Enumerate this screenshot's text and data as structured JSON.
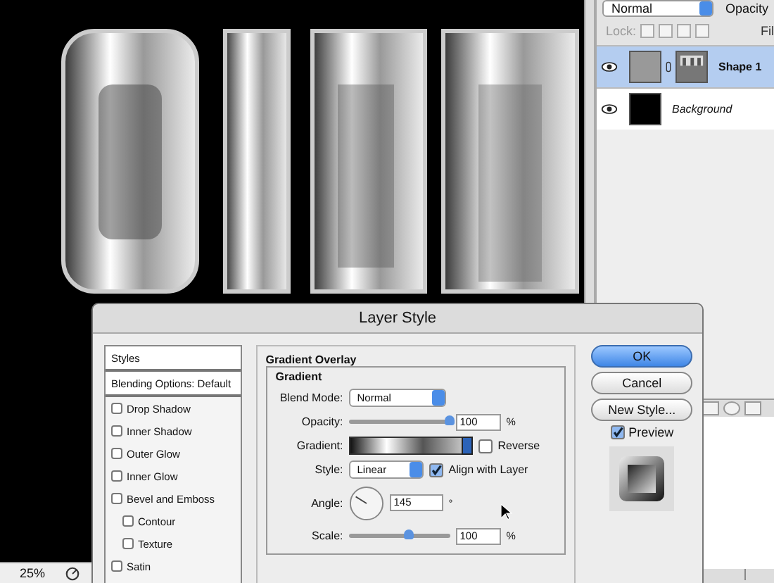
{
  "status_bar": {
    "zoom": "25%"
  },
  "layers_panel": {
    "blend_mode": "Normal",
    "opacity_label": "Opacity",
    "lock_label": "Lock:",
    "fill_label": "Fil",
    "layers": [
      {
        "name": "Shape 1",
        "kind": "shape",
        "selected": true
      },
      {
        "name": "Background",
        "kind": "background",
        "selected": false
      }
    ]
  },
  "dialog": {
    "title": "Layer Style",
    "styles_header": "Styles",
    "blending_options": "Blending Options: Default",
    "effects": [
      {
        "label": "Drop Shadow",
        "checked": false
      },
      {
        "label": "Inner Shadow",
        "checked": false
      },
      {
        "label": "Outer Glow",
        "checked": false
      },
      {
        "label": "Inner Glow",
        "checked": false
      },
      {
        "label": "Bevel and Emboss",
        "checked": false,
        "children": [
          {
            "label": "Contour",
            "checked": false
          },
          {
            "label": "Texture",
            "checked": false
          }
        ]
      },
      {
        "label": "Satin",
        "checked": false
      }
    ],
    "section_title": "Gradient Overlay",
    "group_title": "Gradient",
    "blend_mode": {
      "label": "Blend Mode:",
      "value": "Normal"
    },
    "opacity": {
      "label": "Opacity:",
      "level": 1.0,
      "value": "100",
      "unit": "%"
    },
    "gradient": {
      "label": "Gradient:"
    },
    "reverse": {
      "label": "Reverse",
      "checked": false
    },
    "style": {
      "label": "Style:",
      "value": "Linear"
    },
    "align": {
      "label": "Align with Layer",
      "checked": true
    },
    "angle": {
      "label": "Angle:",
      "value": "145",
      "unit": "°"
    },
    "scale": {
      "label": "Scale:",
      "level": 0.6,
      "value": "100",
      "unit": "%"
    },
    "buttons": [
      {
        "label": "OK",
        "default": true
      },
      {
        "label": "Cancel",
        "default": false
      },
      {
        "label": "New Style...",
        "default": false
      }
    ],
    "preview": {
      "label": "Preview",
      "checked": true
    }
  }
}
